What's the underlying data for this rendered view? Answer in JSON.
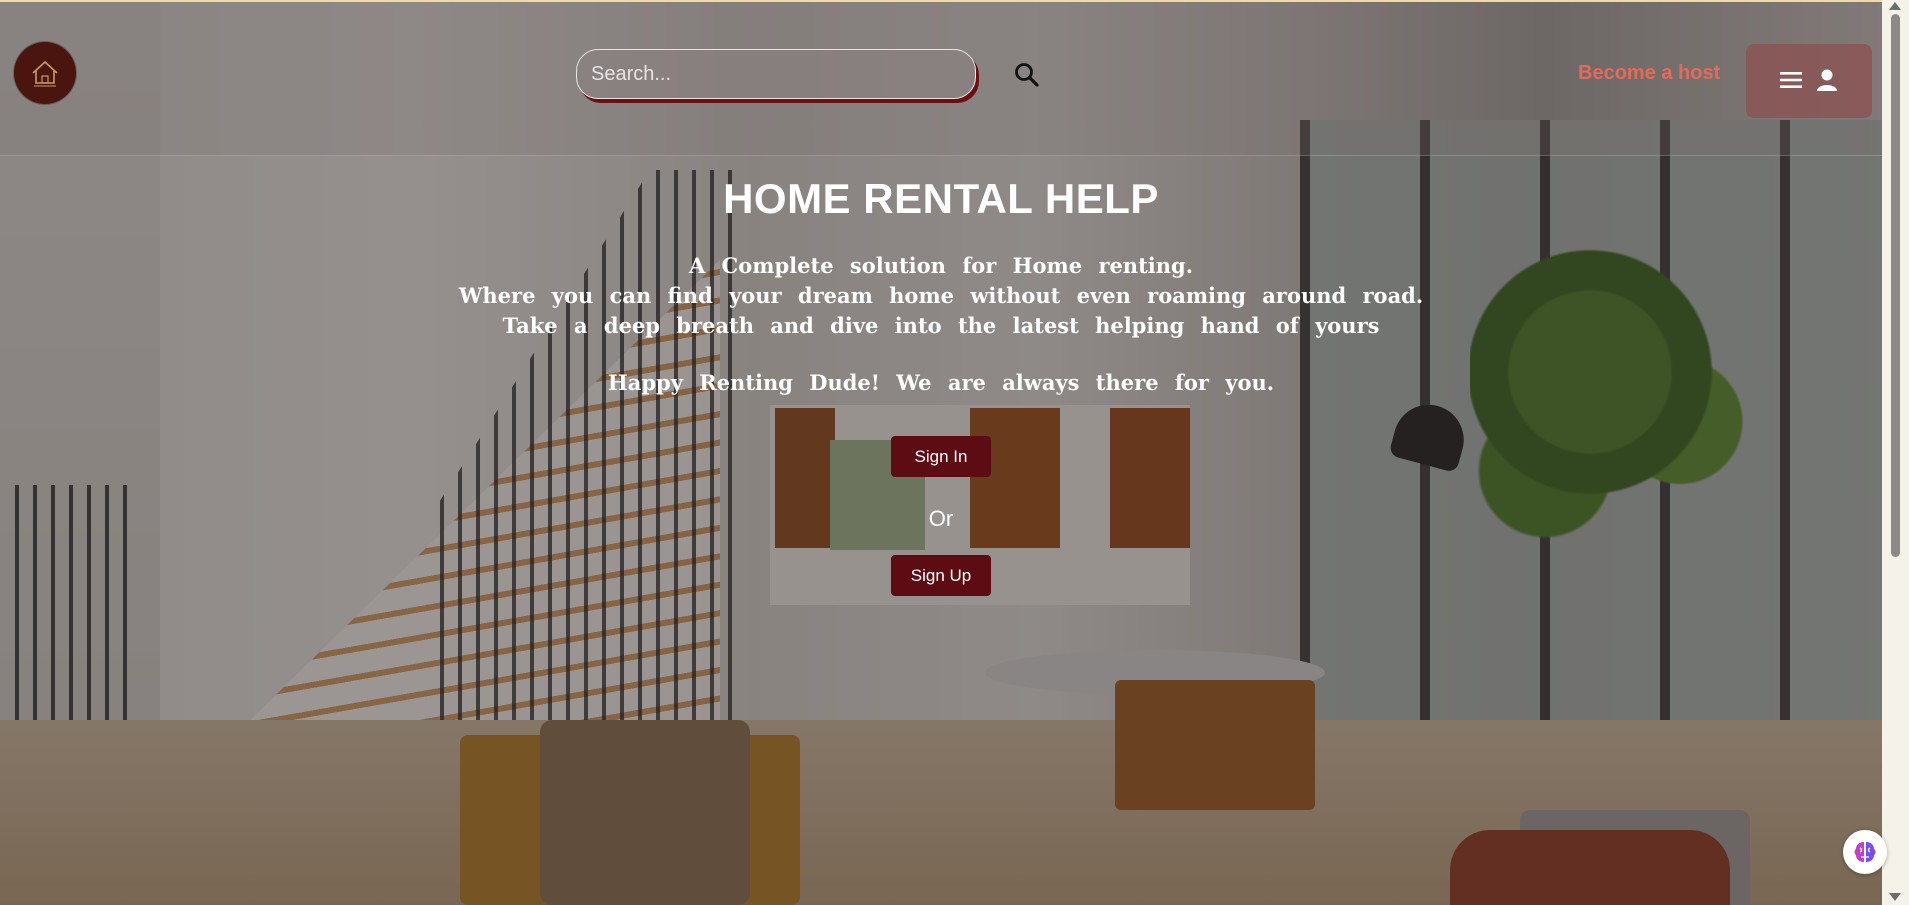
{
  "header": {
    "search": {
      "placeholder": "Search...",
      "value": ""
    },
    "become_host": "Become a host"
  },
  "hero": {
    "title": "HOME RENTAL HELP",
    "tagline_lines": [
      "A Complete solution for Home renting.",
      "Where you can find your dream home without even roaming around road.",
      "Take a deep breath and dive into the latest helping hand of yours",
      "Happy Renting Dude! We are always there for you."
    ],
    "sign_in": "Sign In",
    "or": "Or",
    "sign_up": "Sign Up"
  },
  "icons": {
    "logo": "house-logo-icon",
    "search": "search-icon",
    "menu": "hamburger-menu-icon",
    "user": "user-icon",
    "widget": "brain-icon"
  },
  "colors": {
    "accent": "#e46b5a",
    "button_bg": "#5c0c12",
    "menu_bg": "#8c5050",
    "logo_bg": "#4a140f"
  }
}
